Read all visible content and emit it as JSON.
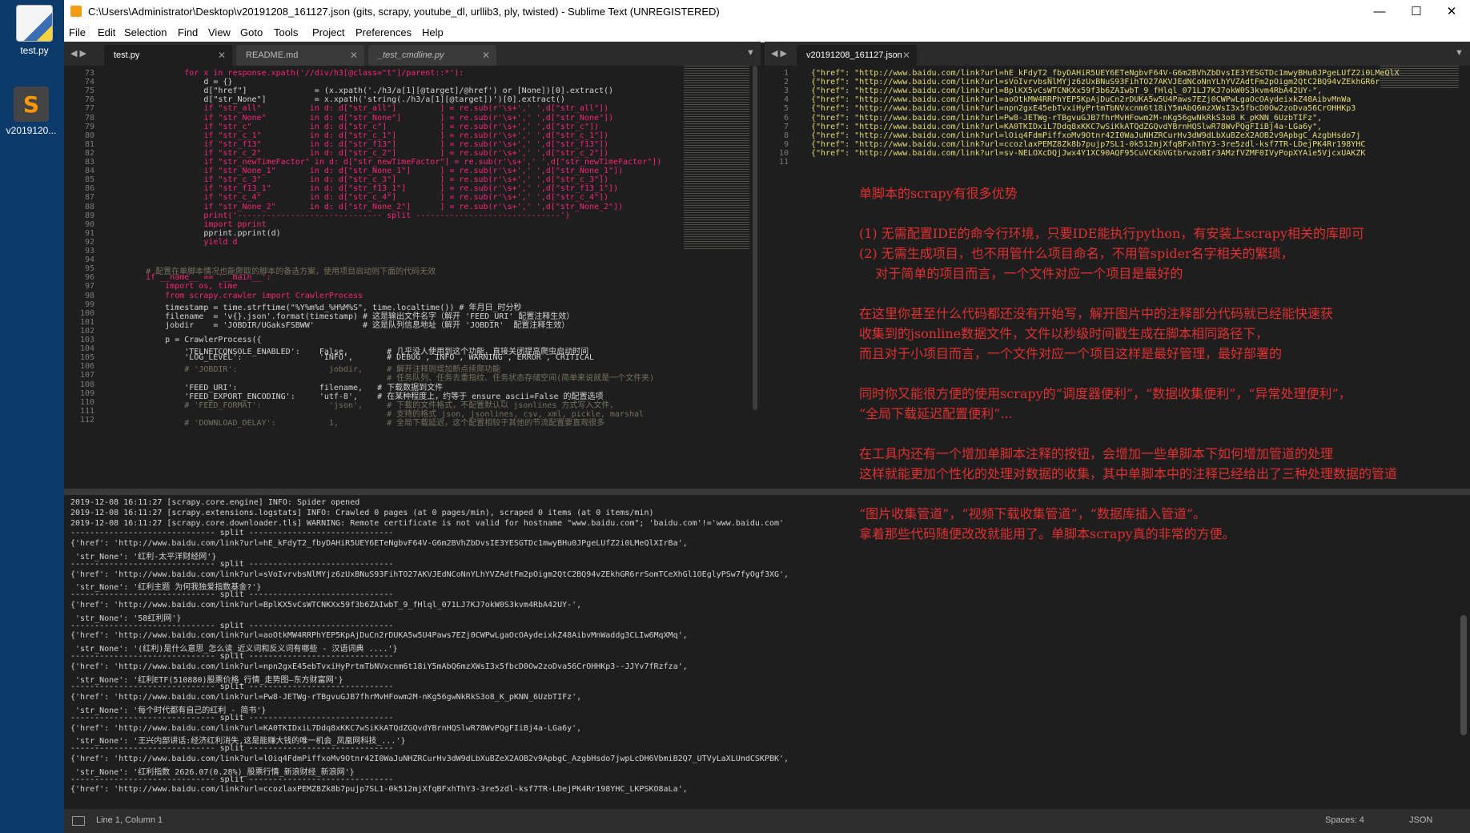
{
  "desktop": {
    "icons": [
      {
        "label": "test.py"
      },
      {
        "label": "v2019120..."
      }
    ]
  },
  "window": {
    "title": "C:\\Users\\Administrator\\Desktop\\v20191208_161127.json (gits, scrapy, youtube_dl, urllib3, ply, twisted) - Sublime Text (UNREGISTERED)",
    "min": "—",
    "max": "☐",
    "close": "✕"
  },
  "menu": [
    "File",
    "Edit",
    "Selection",
    "Find",
    "View",
    "Goto",
    "Tools",
    "Project",
    "Preferences",
    "Help"
  ],
  "tabs_left": [
    {
      "label": "test.py",
      "close": "✕"
    },
    {
      "label": "README.md",
      "close": "✕"
    },
    {
      "label": "_test_cmdline.py",
      "close": "✕"
    }
  ],
  "tabs_right": [
    {
      "label": "v20191208_161127.json",
      "close": "✕"
    }
  ],
  "nav": {
    "arrows": "◀ ▶",
    "dropdown": "▼"
  },
  "code": {
    "lines": [
      {
        "n": "73",
        "t": "            for x in response.xpath('//div/h3[@class=\"t\"]/parent::*'):"
      },
      {
        "n": "74",
        "t": "                d = {}"
      },
      {
        "n": "75",
        "t": "                d[\"href\"]              = (x.xpath('./h3/a[1][@target]/@href') or [None])[0].extract()"
      },
      {
        "n": "76",
        "t": "                d[\"str_None\"]          = x.xpath('string(./h3/a[1][@target])')[0].extract()"
      },
      {
        "n": "77",
        "t": "                if \"str_all\"          in d: d[\"str_all\"]         ] = re.sub(r'\\s+',' ',d[\"str_all\"])"
      },
      {
        "n": "78",
        "t": "                if \"str_None\"         in d: d[\"str_None\"]        ] = re.sub(r'\\s+',' ',d[\"str_None\"])"
      },
      {
        "n": "79",
        "t": "                if \"str_c\"            in d: d[\"str_c\"]           ] = re.sub(r'\\s+',' ',d[\"str_c\"])"
      },
      {
        "n": "80",
        "t": "                if \"str_c_1\"          in d: d[\"str_c_1\"]         ] = re.sub(r'\\s+',' ',d[\"str_c_1\"])"
      },
      {
        "n": "81",
        "t": "                if \"str_f13\"          in d: d[\"str_f13\"]         ] = re.sub(r'\\s+',' ',d[\"str_f13\"])"
      },
      {
        "n": "82",
        "t": "                if \"str_c_2\"          in d: d[\"str_c_2\"]         ] = re.sub(r'\\s+',' ',d[\"str_c_2\"])"
      },
      {
        "n": "83",
        "t": "                if \"str_newTimeFactor\" in d: d[\"str_newTimeFactor\"] = re.sub(r'\\s+',' ',d[\"str_newTimeFactor\"])"
      },
      {
        "n": "84",
        "t": "                if \"str_None_1\"       in d: d[\"str_None_1\"]      ] = re.sub(r'\\s+',' ',d[\"str_None_1\"])"
      },
      {
        "n": "85",
        "t": "                if \"str_c_3\"          in d: d[\"str_c_3\"]         ] = re.sub(r'\\s+',' ',d[\"str_c_3\"])"
      },
      {
        "n": "86",
        "t": "                if \"str_f13_1\"        in d: d[\"str_f13_1\"]       ] = re.sub(r'\\s+',' ',d[\"str_f13_1\"])"
      },
      {
        "n": "87",
        "t": "                if \"str_c_4\"          in d: d[\"str_c_4\"]         ] = re.sub(r'\\s+',' ',d[\"str_c_4\"])"
      },
      {
        "n": "88",
        "t": "                if \"str_None_2\"       in d: d[\"str_None_2\"]      ] = re.sub(r'\\s+',' ',d[\"str_None_2\"])"
      },
      {
        "n": "89",
        "t": "                print('------------------------------ split ------------------------------')"
      },
      {
        "n": "90",
        "t": "                import pprint"
      },
      {
        "n": "91",
        "t": "                pprint.pprint(d)"
      },
      {
        "n": "92",
        "t": "                yield d"
      },
      {
        "n": "93",
        "t": ""
      },
      {
        "n": "94",
        "t": ""
      },
      {
        "n": "95",
        "t": "    # 配置在单脚本情况也能爬取的脚本的备选方案，使用项目启动则下面的代码无效"
      },
      {
        "n": "96",
        "t": "    if __name__ == '__main__':"
      },
      {
        "n": "97",
        "t": "        import os, time"
      },
      {
        "n": "98",
        "t": "        from scrapy.crawler import CrawlerProcess"
      },
      {
        "n": "99",
        "t": "        timestamp = time.strftime(\"%Y%m%d_%H%M%S\", time.localtime()) # 年月日_时分秒"
      },
      {
        "n": "100",
        "t": "        filename  = 'v{}.json'.format(timestamp) # 这是输出文件名字（解开 'FEED_URI' 配置注释生效）"
      },
      {
        "n": "101",
        "t": "        jobdir    = 'JOBDIR/UGaksFSBWW'          # 这是队列信息地址（解开 'JOBDIR'  配置注释生效）"
      },
      {
        "n": "102",
        "t": ""
      },
      {
        "n": "103",
        "t": "        p = CrawlerProcess({"
      },
      {
        "n": "104",
        "t": "            'TELNETCONSOLE_ENABLED':    False,        # 几乎没人使用到这个功能，直接关闭提高爬虫启动时间"
      },
      {
        "n": "105",
        "t": "            'LOG_LEVEL':                'INFO',       # DEBUG , INFO , WARNING , ERROR , CRITICAL"
      },
      {
        "n": "106",
        "t": "            # 'JOBDIR':                   jobdir,     # 解开注释则增加断点续爬功能"
      },
      {
        "n": "107",
        "t": "                                                      # 任务队列、任务去重指纹、任务状态存储空间(简单来说就是一个文件夹)"
      },
      {
        "n": "108",
        "t": "            'FEED_URI':                 filename,   # 下载数据到文件"
      },
      {
        "n": "109",
        "t": "            'FEED_EXPORT_ENCODING':     'utf-8',    # 在某种程度上，约等于 ensure_ascii=False 的配置选项"
      },
      {
        "n": "110",
        "t": "            # 'FEED_FORMAT':              'json',     # 下载的文件格式，不配置默认以 jsonlines 方式写入文件，"
      },
      {
        "n": "111",
        "t": "                                                      # 支持的格式 json, jsonlines, csv, xml, pickle, marshal"
      },
      {
        "n": "112",
        "t": "            # 'DOWNLOAD_DELAY':           1,          # 全局下载延迟，这个配置相较于其他的节流配置要直观很多"
      }
    ]
  },
  "json_file": {
    "lines": [
      {
        "n": "1",
        "t": "{\"href\": \"http://www.baidu.com/link?url=hE_kFdyT2_fbyDAHiR5UEY6ETeNgbvF64V-G6m2BVhZbDvsIE3YESGTDc1mwyBHu0JPgeLUfZ2i0LMeQlX"
      },
      {
        "n": "2",
        "t": "{\"href\": \"http://www.baidu.com/link?url=sVoIvrvbsNlMYjz6zUxBNuS93FihTO27AKVJEdNCoNnYLhYVZAdtFm2pOigm2QtC2BQ94vZEkhGR6r"
      },
      {
        "n": "3",
        "t": "{\"href\": \"http://www.baidu.com/link?url=BplKX5vCsWTCNKXx59f3b6ZAIwbT_9_fHlql_071LJ7KJ7okW0S3kvm4RbA42UY-\","
      },
      {
        "n": "4",
        "t": "{\"href\": \"http://www.baidu.com/link?url=aoOtkMW4RRPhYEP5KpAjDuCn2rDUKA5w5U4Paws7EZj0CWPwLgaOcOAydeixkZ48AibvMnWa"
      },
      {
        "n": "5",
        "t": "{\"href\": \"http://www.baidu.com/link?url=npn2gxE45ebTvxiHyPrtmTbNVxcnm6t18iY5mAbQ6mzXWsI3x5fbcD0Ow2zoDva56CrOHHKp3"
      },
      {
        "n": "6",
        "t": "{\"href\": \"http://www.baidu.com/link?url=Pw8-JETWg-rTBgvuGJB7fhrMvHFowm2M-nKg56gwNkRkS3o8_K_pKNN_6UzbTIFz\","
      },
      {
        "n": "7",
        "t": "{\"href\": \"http://www.baidu.com/link?url=KA0TKIDxiL7Ddq8xKKC7wSiKkATQdZGQvdYBrnHQSlwR78WvPQgFIiBj4a-LGa6y\","
      },
      {
        "n": "8",
        "t": "{\"href\": \"http://www.baidu.com/link?url=lOiq4FdmPiffxoMv9Otnr42I0WaJuNHZRCurHv3dW9dLbXuBZeX2AOB2v9ApbgC_AzgbHsdo7j"
      },
      {
        "n": "9",
        "t": "{\"href\": \"http://www.baidu.com/link?url=ccozlaxPEMZ8Zk8b7pujp7SL1-0k512mjXfqBFxhThY3-3re5zdl-ksf7TR-LDejPK4Rr198YHC"
      },
      {
        "n": "10",
        "t": "{\"href\": \"http://www.baidu.com/link?url=sv-NELOXcDQjJwx4Y1XC90AQF95CuVCKbVGtbrwzoBIr3AMzfVZMF0IVyPopXYAie5VjcxUAKZK"
      },
      {
        "n": "11",
        "t": ""
      }
    ]
  },
  "annotation": {
    "lines": [
      "单脚本的scrapy有很多优势",
      "",
      "(1) 无需配置IDE的命令行环境，只要IDE能执行python，有安装上scrapy相关的库即可",
      "(2) 无需生成项目，也不用管什么项目命名，不用管spider名字相关的繁琐，",
      "    对于简单的项目而言，一个文件对应一个项目是最好的",
      "",
      "在这里你甚至什么代码都还没有开始写，解开图片中的注释部分代码就已经能快速获",
      "收集到的jsonline数据文件，文件以秒级时间戳生成在脚本相同路径下，",
      "而且对于小项目而言，一个文件对应一个项目这样是最好管理，最好部署的",
      "",
      "同时你又能很方便的使用scrapy的“调度器便利”，“数据收集便利”，“异常处理便利”，",
      "“全局下载延迟配置便利”...",
      "",
      "在工具内还有一个增加单脚本注释的按钮，会增加一些单脚本下如何增加管道的处理",
      "这样就能更加个性化的处理对数据的收集，其中单脚本中的注释已经给出了三种处理数据的管道",
      "",
      "“图片收集管道”，“视频下载收集管道”，“数据库插入管道”。",
      "拿着那些代码随便改改就能用了。单脚本scrapy真的非常的方便。"
    ]
  },
  "console": {
    "lines": [
      "2019-12-08 16:11:27 [scrapy.core.engine] INFO: Spider opened",
      "2019-12-08 16:11:27 [scrapy.extensions.logstats] INFO: Crawled 0 pages (at 0 pages/min), scraped 0 items (at 0 items/min)",
      "2019-12-08 16:11:27 [scrapy.core.downloader.tls] WARNING: Remote certificate is not valid for hostname \"www.baidu.com\"; 'baidu.com'!='www.baidu.com'",
      "------------------------------ split ------------------------------",
      "{'href': 'http://www.baidu.com/link?url=hE_kFdyT2_fbyDAHiR5UEY6ETeNgbvF64V-G6m2BVhZbDvsIE3YESGTDc1mwyBHu0JPgeLUfZ2i0LMeQlXIrBa',",
      " 'str_None': '红利-太平洋财经网'}",
      "------------------------------ split ------------------------------",
      "{'href': 'http://www.baidu.com/link?url=sVoIvrvbsNlMYjz6zUxBNuS93FihTO27AKVJEdNCoNnYLhYVZAdtFm2pOigm2QtC2BQ94vZEkhGR6rrSomTCeXhGl1OEglyPSw7fyOgf3XG',",
      " 'str_None': '红利主题 为何我独爱指数基金?'}",
      "------------------------------ split ------------------------------",
      "{'href': 'http://www.baidu.com/link?url=BplKX5vCsWTCNKXx59f3b6ZAIwbT_9_fHlql_071LJ7KJ7okW0S3kvm4RbA42UY-',",
      " 'str_None': '58红利网'}",
      "------------------------------ split ------------------------------",
      "{'href': 'http://www.baidu.com/link?url=aoOtkMW4RRPhYEP5KpAjDuCn2rDUKA5w5U4Paws7EZj0CWPwLgaOcOAydeixkZ48AibvMnWaddg3CLIw6MqXMq',",
      " 'str_None': '(红利)是什么意思_怎么读_近义词和反义词有哪些 - 汉语词典 ....'}",
      "------------------------------ split ------------------------------",
      "{'href': 'http://www.baidu.com/link?url=npn2gxE45ebTvxiHyPrtmTbNVxcnm6t18iY5mAbQ6mzXWsI3x5fbcD0Ow2zoDva56CrOHHKp3--JJYv7fRzfza',",
      " 'str_None': '红利ETF(510880)股票价格_行情_走势图—东方财富网'}",
      "------------------------------ split ------------------------------",
      "{'href': 'http://www.baidu.com/link?url=Pw8-JETWg-rTBgvuGJB7fhrMvHFowm2M-nKg56gwNkRkS3o8_K_pKNN_6UzbTIFz',",
      " 'str_None': '每个时代都有自己的红利 - 简书'}",
      "------------------------------ split ------------------------------",
      "{'href': 'http://www.baidu.com/link?url=KA0TKIDxiL7Ddq8xKKC7wSiKkATQdZGQvdYBrnHQSlwR78WvPQgFIiBj4a-LGa6y',",
      " 'str_None': '王兴内部讲话:经济红利消失,这是能赚大钱的唯一机会_凤凰网科技_...'}",
      "------------------------------ split ------------------------------",
      "{'href': 'http://www.baidu.com/link?url=lOiq4FdmPiffxoMv9Otnr42I0WaJuNHZRCurHv3dW9dLbXuBZeX2AOB2v9ApbgC_AzgbHsdo7jwpLcDH6VbmiB2Q7_UTVyLaXLUndCSKPBK',",
      " 'str_None': '红利指数 2626.07(0.28%)_股票行情_新浪财经_新浪网'}",
      "------------------------------ split ------------------------------",
      "{'href': 'http://www.baidu.com/link?url=ccozlaxPEMZ8Zk8b7pujp7SL1-0k512mjXfqBFxhThY3-3re5zdl-ksf7TR-LDejPK4Rr198YHC_LKPSKO8aLa',"
    ]
  },
  "status": {
    "position": "Line 1, Column 1",
    "spaces": "Spaces: 4",
    "syntax": "JSON"
  }
}
